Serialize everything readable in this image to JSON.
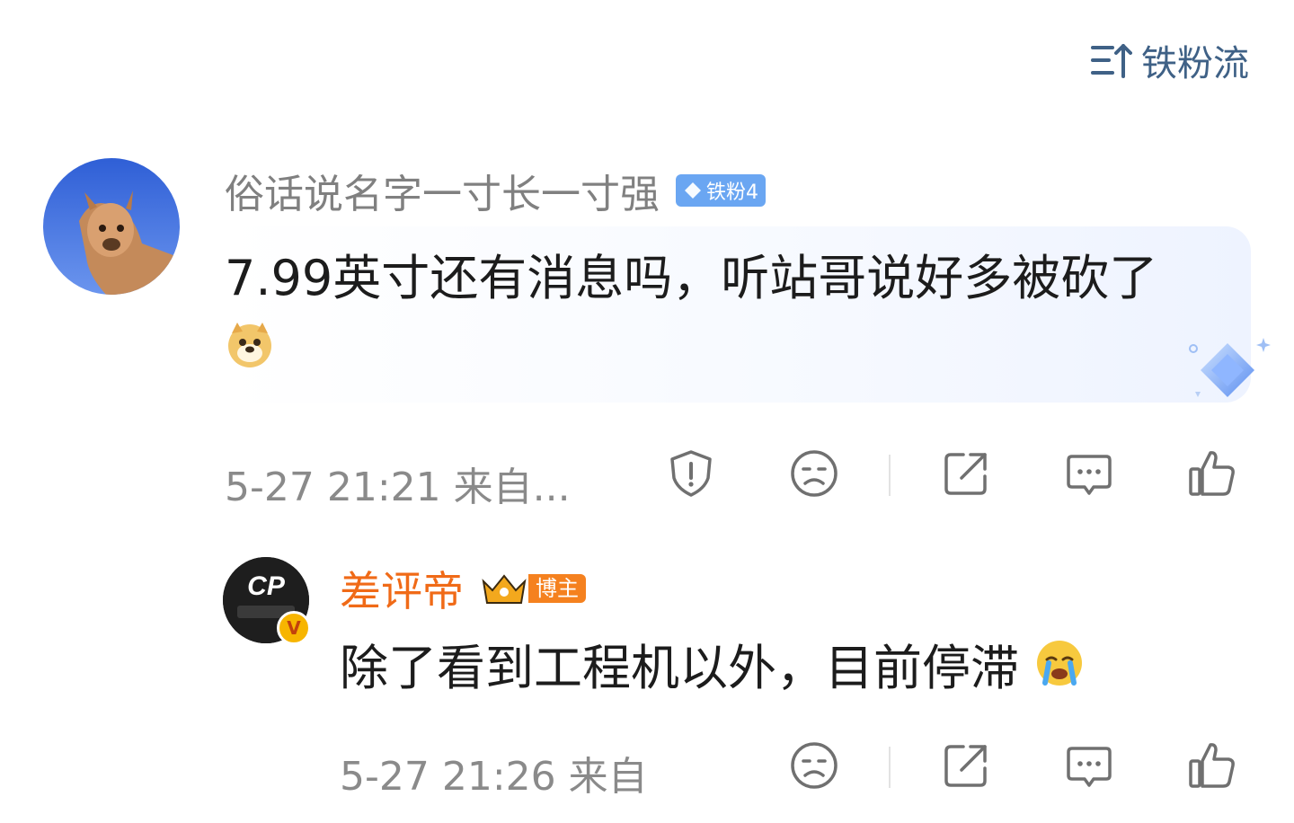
{
  "sort": {
    "label": "铁粉流",
    "icon": "sort-icon"
  },
  "comment": {
    "username": "俗话说名字一寸长一寸强",
    "badge": "铁粉4",
    "content": "7.99英寸还有消息吗，听站哥说好多被砍了",
    "emoji": "doge-emoji",
    "time": "5-27 21:21",
    "source": "来自...",
    "actions": [
      "report-icon",
      "dislike-icon",
      "share-icon",
      "reply-icon",
      "like-icon"
    ]
  },
  "reply": {
    "username": "差评帝",
    "badge": "博主",
    "content": "除了看到工程机以外，目前停滞",
    "emoji": "crying-emoji",
    "time": "5-27 21:26",
    "source": "来自",
    "actions": [
      "dislike-icon",
      "share-icon",
      "reply-icon",
      "like-icon"
    ]
  },
  "colors": {
    "link_blue": "#3f6186",
    "blogger_orange": "#f06a17",
    "fan_badge_blue": "#6aa6f2",
    "meta_gray": "#8a8a8a"
  }
}
